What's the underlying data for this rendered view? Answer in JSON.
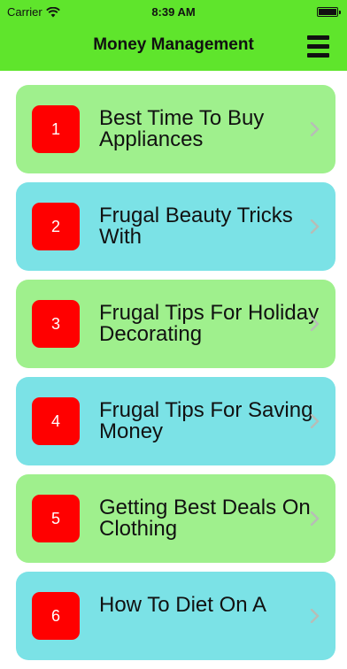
{
  "status_bar": {
    "carrier": "Carrier",
    "time": "8:39 AM",
    "battery_level": 1.0
  },
  "nav": {
    "title": "Money Management"
  },
  "items": [
    {
      "number": "1",
      "title": "Best Time To Buy Appliances",
      "color": "#9ff08d"
    },
    {
      "number": "2",
      "title": "Frugal Beauty Tricks With",
      "color": "#7be2e6"
    },
    {
      "number": "3",
      "title": "Frugal Tips For Holiday Decorating",
      "color": "#9ff08d"
    },
    {
      "number": "4",
      "title": "Frugal Tips For Saving Money",
      "color": "#7be2e6"
    },
    {
      "number": "5",
      "title": "Getting Best Deals On Clothing",
      "color": "#9ff08d"
    },
    {
      "number": "6",
      "title": "How To Diet On A",
      "color": "#7be2e6"
    }
  ],
  "colors": {
    "header": "#5fe52c",
    "badge": "#ff0000",
    "card_green": "#9ff08d",
    "card_cyan": "#7be2e6"
  },
  "icons": {
    "menu": "hamburger-menu-icon",
    "chevron": "chevron-right-icon",
    "wifi": "wifi-icon",
    "battery": "battery-icon"
  }
}
